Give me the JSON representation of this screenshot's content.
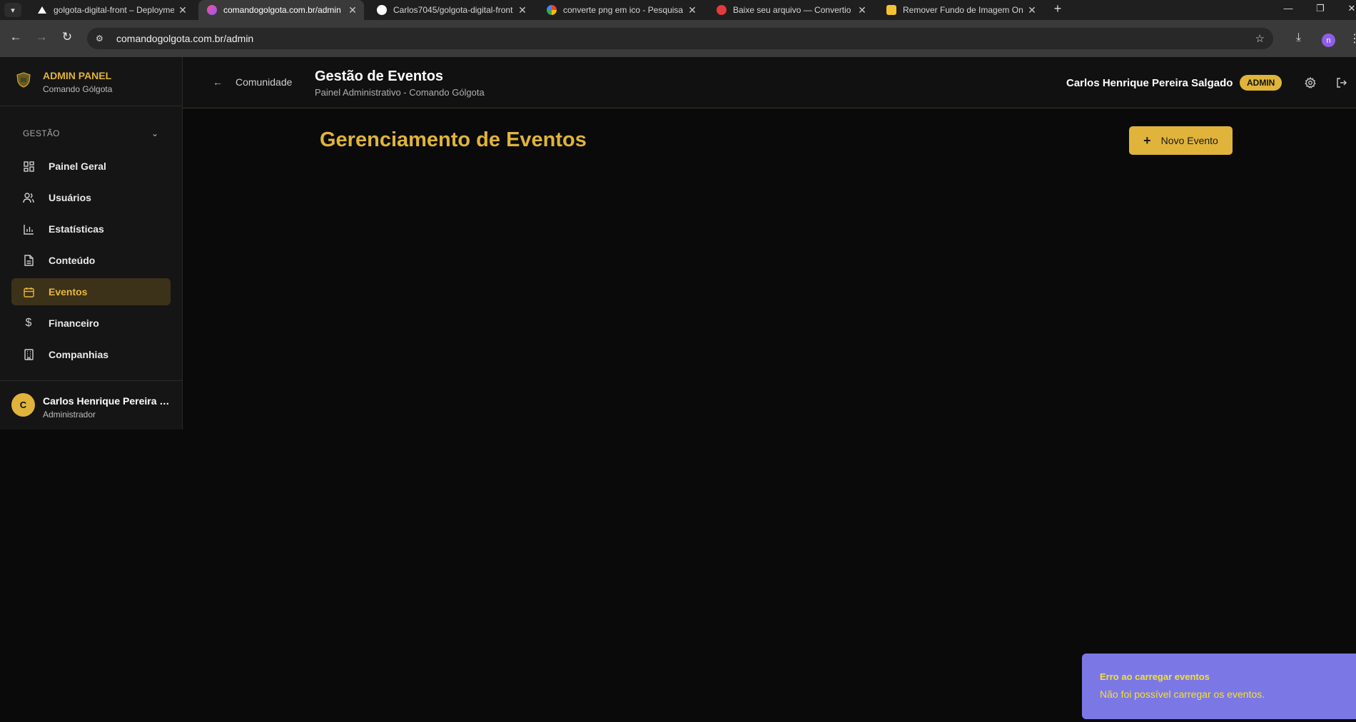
{
  "browser": {
    "tabs": [
      {
        "title": "golgota-digital-front – Deployments",
        "icon": "vercel-icon"
      },
      {
        "title": "comandogolgota.com.br/admin",
        "icon": "lovable-icon"
      },
      {
        "title": "Carlos7045/golgota-digital-front",
        "icon": "github-icon"
      },
      {
        "title": "converte png em ico - Pesquisa Google",
        "icon": "google-icon"
      },
      {
        "title": "Baixe seu arquivo — Convertio",
        "icon": "convertio-icon"
      },
      {
        "title": "Remover Fundo de Imagem Online",
        "icon": "remove-bg-icon"
      }
    ],
    "active_tab_index": 1,
    "url": "comandogolgota.com.br/admin",
    "profile_initial": "n"
  },
  "sidebar": {
    "brand_title": "ADMIN PANEL",
    "brand_subtitle": "Comando Gólgota",
    "section_label": "GESTÃO",
    "items": [
      {
        "label": "Painel Geral",
        "icon": "dashboard-icon"
      },
      {
        "label": "Usuários",
        "icon": "users-icon"
      },
      {
        "label": "Estatísticas",
        "icon": "bar-chart-icon"
      },
      {
        "label": "Conteúdo",
        "icon": "document-icon"
      },
      {
        "label": "Eventos",
        "icon": "calendar-icon",
        "active": true
      },
      {
        "label": "Financeiro",
        "icon": "dollar-icon"
      },
      {
        "label": "Companhias",
        "icon": "building-icon"
      }
    ],
    "user": {
      "initial": "C",
      "name": "Carlos Henrique Pereira S...",
      "role": "Administrador"
    }
  },
  "header": {
    "back_label": "Comunidade",
    "title": "Gestão de Eventos",
    "subtitle": "Painel Administrativo - Comando Gólgota",
    "user_name": "Carlos Henrique Pereira Salgado",
    "badge": "ADMIN"
  },
  "main": {
    "title": "Gerenciamento de Eventos",
    "new_button": "Novo Evento"
  },
  "toast": {
    "title": "Erro ao carregar eventos",
    "message": "Não foi possível carregar os eventos."
  },
  "colors": {
    "accent": "#e0b43a",
    "toast_bg": "#7b78e6",
    "toast_text": "#f2e035"
  }
}
